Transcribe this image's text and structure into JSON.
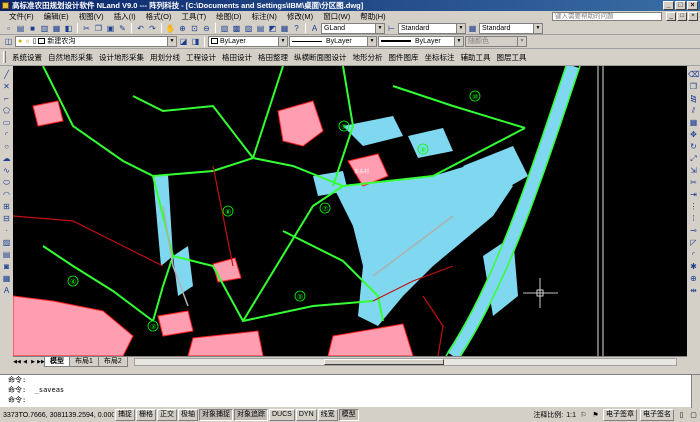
{
  "window": {
    "title": "高标准农田规划设计软件 NLand V9.0 --- 阵列科技 - [C:\\Documents and Settings\\IBM\\桌面\\分区图.dwg]",
    "controls": [
      "_",
      "□",
      "×"
    ]
  },
  "menu": {
    "items": [
      "文件(F)",
      "编辑(E)",
      "视图(V)",
      "插入(I)",
      "格式(O)",
      "工具(T)",
      "绘图(D)",
      "标注(N)",
      "修改(M)",
      "窗口(W)",
      "帮助(H)"
    ],
    "help_placeholder": "键入需要帮助的问题",
    "mdi_controls": [
      "_",
      "□",
      "×"
    ]
  },
  "toolbar1": {
    "text_style": "GLand",
    "dim_style": "Standard",
    "table_style": "Standard"
  },
  "toolbar2": {
    "layer_value": "新建农沟",
    "color_value": "ByLayer",
    "linetype_value": "ByLayer",
    "lineweight_value": "ByLayer",
    "plotstyle_value": "随颜色"
  },
  "plugin_menu": {
    "items": [
      "系统设置",
      "自然地形采集",
      "设计地形采集",
      "用划分线",
      "工程设计",
      "格田设计",
      "格田整理",
      "纵横断面图设计",
      "地形分析",
      "图件图库",
      "坐标标注",
      "辅助工具",
      "图层工具"
    ]
  },
  "canvas": {
    "zone_labels": [
      "①",
      "②",
      "③",
      "④",
      "⑤",
      "⑥",
      "⑦",
      "⑧",
      "⑨",
      "⑩"
    ],
    "place_label": "东头村"
  },
  "layout_tabs": {
    "items": [
      "模型",
      "布局1",
      "布局2"
    ],
    "nav": [
      "◀◀",
      "◀",
      "▶",
      "▶▶"
    ]
  },
  "command": {
    "lines": [
      "命令:",
      "命令:  _saveas",
      "命令:"
    ]
  },
  "status": {
    "coords": "3373TO.7666, 3081139.2594, 0.0000",
    "toggles": [
      "捕捉",
      "栅格",
      "正交",
      "极轴",
      "对象捕捉",
      "对象追踪",
      "DUCS",
      "DYN",
      "线宽",
      "模型"
    ],
    "on_toggles": [
      "对象捕捉",
      "对象追踪",
      "模型"
    ],
    "annotation_scale_label": "注释比例:",
    "annotation_scale_value": "1:1",
    "right_buttons": [
      "电子签章",
      "电子签名"
    ]
  },
  "colors": {
    "farmland_pink": "#ff9eb0",
    "water_cyan": "#7fd8f0",
    "boundary_green": "#33ff33",
    "road_red": "#ff2020",
    "title_blue": "#0a246a"
  }
}
